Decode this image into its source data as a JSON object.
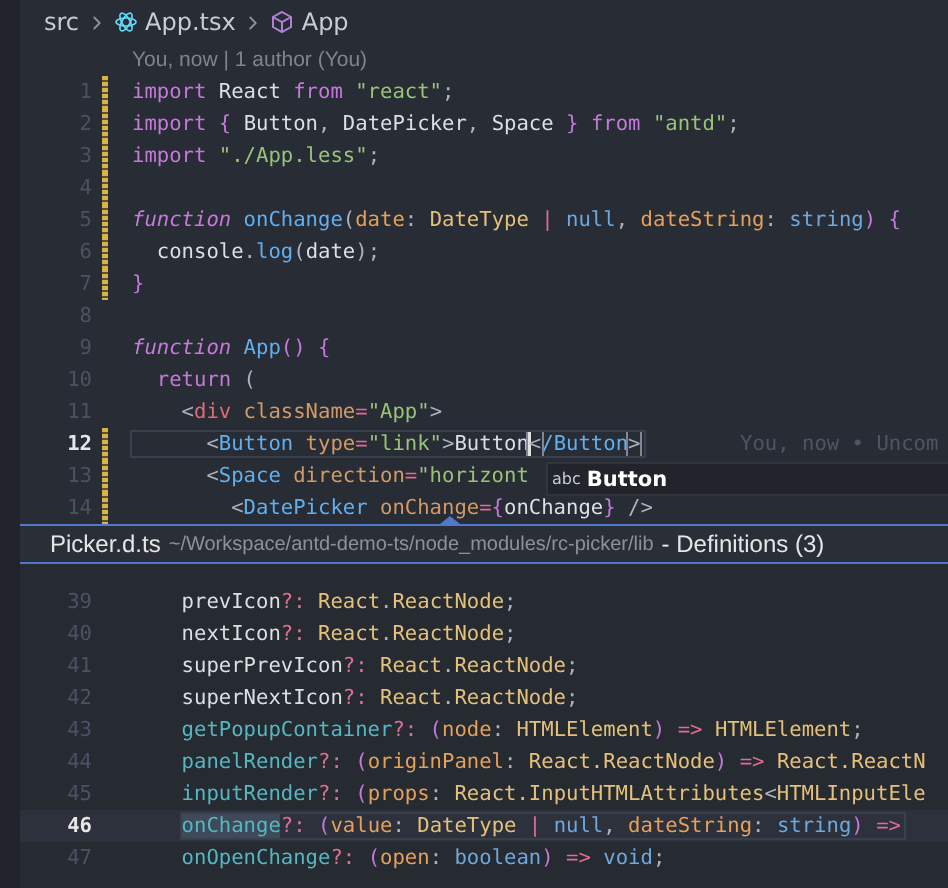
{
  "breadcrumb": [
    {
      "label": "src",
      "kind": "folder"
    },
    {
      "label": "App.tsx",
      "kind": "file"
    },
    {
      "label": "App",
      "kind": "symbol"
    }
  ],
  "blame": "You, now | 1 author (You)",
  "editor": {
    "lines": [
      {
        "number": "1",
        "modified": true,
        "current": false,
        "tokens": [
          {
            "text": "import ",
            "kind": "kw"
          },
          {
            "text": "React ",
            "kind": "id"
          },
          {
            "text": "from ",
            "kind": "kw"
          },
          {
            "text": "\"react\"",
            "kind": "str"
          },
          {
            "text": ";",
            "kind": "punc"
          }
        ]
      },
      {
        "number": "2",
        "modified": true,
        "current": false,
        "tokens": [
          {
            "text": "import ",
            "kind": "kw"
          },
          {
            "text": "{ ",
            "kind": "brace"
          },
          {
            "text": "Button",
            "kind": "id"
          },
          {
            "text": ", ",
            "kind": "punc"
          },
          {
            "text": "DatePicker",
            "kind": "id"
          },
          {
            "text": ", ",
            "kind": "punc"
          },
          {
            "text": "Space ",
            "kind": "id"
          },
          {
            "text": "} ",
            "kind": "brace"
          },
          {
            "text": "from ",
            "kind": "kw"
          },
          {
            "text": "\"antd\"",
            "kind": "str"
          },
          {
            "text": ";",
            "kind": "punc"
          }
        ]
      },
      {
        "number": "3",
        "modified": true,
        "current": false,
        "tokens": [
          {
            "text": "import ",
            "kind": "kw"
          },
          {
            "text": "\"./App.less\"",
            "kind": "str"
          },
          {
            "text": ";",
            "kind": "punc"
          }
        ]
      },
      {
        "number": "4",
        "modified": true,
        "current": false
      },
      {
        "number": "5",
        "modified": true,
        "current": false,
        "tokens": [
          {
            "text": "function ",
            "kind": "kwi"
          },
          {
            "text": "onChange",
            "kind": "fn"
          },
          {
            "text": "(",
            "kind": "punc"
          },
          {
            "text": "date",
            "kind": "param"
          },
          {
            "text": ": ",
            "kind": "punc"
          },
          {
            "text": "DateType ",
            "kind": "type"
          },
          {
            "text": "| ",
            "kind": "op"
          },
          {
            "text": "null",
            "kind": "const"
          },
          {
            "text": ", ",
            "kind": "punc"
          },
          {
            "text": "dateString",
            "kind": "param"
          },
          {
            "text": ": ",
            "kind": "punc"
          },
          {
            "text": "string",
            "kind": "const"
          },
          {
            "text": ") {",
            "kind": "brace"
          }
        ]
      },
      {
        "number": "6",
        "modified": true,
        "current": false,
        "tokens": [
          {
            "text": "  console",
            "kind": "id"
          },
          {
            "text": ".",
            "kind": "punc"
          },
          {
            "text": "log",
            "kind": "fn"
          },
          {
            "text": "(",
            "kind": "punc"
          },
          {
            "text": "date",
            "kind": "id"
          },
          {
            "text": ");",
            "kind": "punc"
          }
        ]
      },
      {
        "number": "7",
        "modified": true,
        "current": false,
        "tokens": [
          {
            "text": "}",
            "kind": "brace"
          }
        ]
      },
      {
        "number": "8",
        "modified": false,
        "current": false
      },
      {
        "number": "9",
        "modified": false,
        "current": false,
        "tokens": [
          {
            "text": "function ",
            "kind": "kwi"
          },
          {
            "text": "App",
            "kind": "fn"
          },
          {
            "text": "() {",
            "kind": "brace"
          }
        ]
      },
      {
        "number": "10",
        "modified": false,
        "current": false,
        "tokens": [
          {
            "text": "  return ",
            "kind": "kw"
          },
          {
            "text": "(",
            "kind": "punc"
          }
        ]
      },
      {
        "number": "11",
        "modified": false,
        "current": false,
        "tokens": [
          {
            "text": "    <",
            "kind": "punc"
          },
          {
            "text": "div",
            "kind": "tag"
          },
          {
            "text": " className",
            "kind": "attr"
          },
          {
            "text": "=",
            "kind": "op"
          },
          {
            "text": "\"App\"",
            "kind": "str"
          },
          {
            "text": ">",
            "kind": "punc"
          }
        ]
      },
      {
        "number": "12",
        "modified": true,
        "current": true,
        "tokens": [
          {
            "text": "      <",
            "kind": "punc"
          },
          {
            "text": "Button",
            "kind": "comp"
          },
          {
            "text": " type",
            "kind": "attr"
          },
          {
            "text": "=",
            "kind": "op"
          },
          {
            "text": "\"link\"",
            "kind": "str"
          },
          {
            "text": ">",
            "kind": "punc"
          },
          {
            "text": "Button",
            "kind": "id",
            "cursor": true
          },
          {
            "text": "<",
            "kind": "punc",
            "matched": true
          },
          {
            "text": "/Button",
            "kind": "comp"
          },
          {
            "text": ">",
            "kind": "punc",
            "matched": true
          }
        ],
        "inline_blame": "You, now • Uncom"
      },
      {
        "number": "13",
        "modified": true,
        "current": false,
        "tokens": [
          {
            "text": "      <",
            "kind": "punc"
          },
          {
            "text": "Space",
            "kind": "comp"
          },
          {
            "text": " direction",
            "kind": "attr"
          },
          {
            "text": "=",
            "kind": "op"
          },
          {
            "text": "\"horizont",
            "kind": "str"
          }
        ]
      },
      {
        "number": "14",
        "modified": true,
        "current": false,
        "tokens": [
          {
            "text": "        <",
            "kind": "punc"
          },
          {
            "text": "DatePicker",
            "kind": "comp"
          },
          {
            "text": " onChange",
            "kind": "attr"
          },
          {
            "text": "=",
            "kind": "op"
          },
          {
            "text": "{",
            "kind": "brace"
          },
          {
            "text": "onChange",
            "kind": "id"
          },
          {
            "text": "} ",
            "kind": "brace"
          },
          {
            "text": "/>",
            "kind": "punc"
          }
        ]
      }
    ],
    "suggestion": {
      "kind_label": "abc",
      "label": "Button"
    }
  },
  "peek": {
    "file": "Picker.d.ts",
    "path": "~/Workspace/antd-demo-ts/node_modules/rc-picker/lib",
    "title": "- Definitions (3)",
    "lines": [
      {
        "number": "39",
        "current": false,
        "tokens": [
          {
            "text": "prevIcon",
            "kind": "id"
          },
          {
            "text": "?: ",
            "kind": "op"
          },
          {
            "text": "React",
            "kind": "type"
          },
          {
            "text": ".",
            "kind": "punc"
          },
          {
            "text": "ReactNode",
            "kind": "type"
          },
          {
            "text": ";",
            "kind": "punc"
          }
        ]
      },
      {
        "number": "40",
        "current": false,
        "tokens": [
          {
            "text": "nextIcon",
            "kind": "id"
          },
          {
            "text": "?: ",
            "kind": "op"
          },
          {
            "text": "React",
            "kind": "type"
          },
          {
            "text": ".",
            "kind": "punc"
          },
          {
            "text": "ReactNode",
            "kind": "type"
          },
          {
            "text": ";",
            "kind": "punc"
          }
        ]
      },
      {
        "number": "41",
        "current": false,
        "tokens": [
          {
            "text": "superPrevIcon",
            "kind": "id"
          },
          {
            "text": "?: ",
            "kind": "op"
          },
          {
            "text": "React",
            "kind": "type"
          },
          {
            "text": ".",
            "kind": "punc"
          },
          {
            "text": "ReactNode",
            "kind": "type"
          },
          {
            "text": ";",
            "kind": "punc"
          }
        ]
      },
      {
        "number": "42",
        "current": false,
        "tokens": [
          {
            "text": "superNextIcon",
            "kind": "id"
          },
          {
            "text": "?: ",
            "kind": "op"
          },
          {
            "text": "React",
            "kind": "type"
          },
          {
            "text": ".",
            "kind": "punc"
          },
          {
            "text": "ReactNode",
            "kind": "type"
          },
          {
            "text": ";",
            "kind": "punc"
          }
        ]
      },
      {
        "number": "43",
        "current": false,
        "tokens": [
          {
            "text": "getPopupContainer",
            "kind": "method"
          },
          {
            "text": "?: ",
            "kind": "op"
          },
          {
            "text": "(",
            "kind": "brace"
          },
          {
            "text": "node",
            "kind": "param"
          },
          {
            "text": ": ",
            "kind": "punc"
          },
          {
            "text": "HTMLElement",
            "kind": "type"
          },
          {
            "text": ") ",
            "kind": "brace"
          },
          {
            "text": "=> ",
            "kind": "op"
          },
          {
            "text": "HTMLElement",
            "kind": "type"
          },
          {
            "text": ";",
            "kind": "punc"
          }
        ]
      },
      {
        "number": "44",
        "current": false,
        "tokens": [
          {
            "text": "panelRender",
            "kind": "method"
          },
          {
            "text": "?: ",
            "kind": "op"
          },
          {
            "text": "(",
            "kind": "brace"
          },
          {
            "text": "originPanel",
            "kind": "param"
          },
          {
            "text": ": ",
            "kind": "punc"
          },
          {
            "text": "React.ReactNode",
            "kind": "type"
          },
          {
            "text": ") ",
            "kind": "brace"
          },
          {
            "text": "=> ",
            "kind": "op"
          },
          {
            "text": "React.ReactN",
            "kind": "type"
          }
        ]
      },
      {
        "number": "45",
        "current": false,
        "tokens": [
          {
            "text": "inputRender",
            "kind": "method"
          },
          {
            "text": "?: ",
            "kind": "op"
          },
          {
            "text": "(",
            "kind": "brace"
          },
          {
            "text": "props",
            "kind": "param"
          },
          {
            "text": ": ",
            "kind": "punc"
          },
          {
            "text": "React.InputHTMLAttributes",
            "kind": "type"
          },
          {
            "text": "<",
            "kind": "punc"
          },
          {
            "text": "HTMLInputEle",
            "kind": "type"
          }
        ]
      },
      {
        "number": "46",
        "current": true,
        "tokens": [
          {
            "text": "onChange",
            "kind": "method",
            "highlight": true
          },
          {
            "text": "?: ",
            "kind": "op"
          },
          {
            "text": "(",
            "kind": "brace"
          },
          {
            "text": "value",
            "kind": "param"
          },
          {
            "text": ": ",
            "kind": "punc"
          },
          {
            "text": "DateType ",
            "kind": "type"
          },
          {
            "text": "| ",
            "kind": "op"
          },
          {
            "text": "null",
            "kind": "const"
          },
          {
            "text": ", ",
            "kind": "punc"
          },
          {
            "text": "dateString",
            "kind": "param"
          },
          {
            "text": ": ",
            "kind": "punc"
          },
          {
            "text": "string",
            "kind": "const"
          },
          {
            "text": ") ",
            "kind": "brace"
          },
          {
            "text": "=>",
            "kind": "op"
          }
        ]
      },
      {
        "number": "47",
        "current": false,
        "tokens": [
          {
            "text": "onOpenChange",
            "kind": "method"
          },
          {
            "text": "?: ",
            "kind": "op"
          },
          {
            "text": "(",
            "kind": "brace"
          },
          {
            "text": "open",
            "kind": "param"
          },
          {
            "text": ": ",
            "kind": "punc"
          },
          {
            "text": "boolean",
            "kind": "const"
          },
          {
            "text": ") ",
            "kind": "brace"
          },
          {
            "text": "=> ",
            "kind": "op"
          },
          {
            "text": "void",
            "kind": "const"
          },
          {
            "text": ";",
            "kind": "punc"
          }
        ]
      }
    ]
  }
}
